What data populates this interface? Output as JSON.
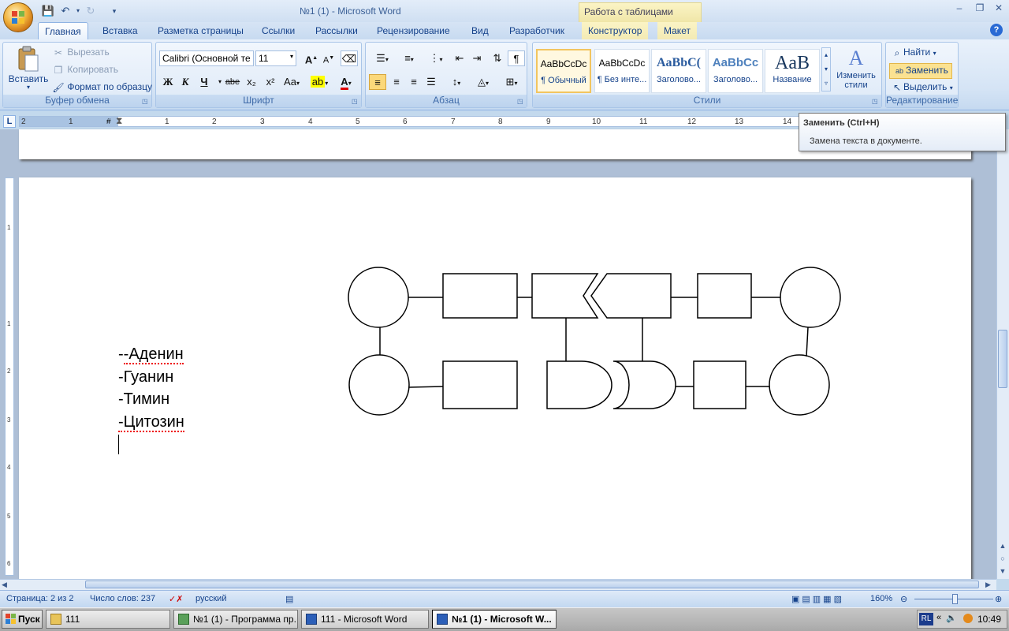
{
  "window": {
    "title": "№1 (1) - Microsoft Word",
    "context_tab": "Работа с таблицами"
  },
  "qat": {
    "save": "save-icon",
    "undo": "undo-icon",
    "redo": "redo-icon",
    "customize": "customize-icon"
  },
  "tabs": [
    "Главная",
    "Вставка",
    "Разметка страницы",
    "Ссылки",
    "Рассылки",
    "Рецензирование",
    "Вид",
    "Разработчик",
    "Конструктор",
    "Макет"
  ],
  "active_tab": "Главная",
  "clipboard": {
    "paste": "Вставить",
    "cut": "Вырезать",
    "copy": "Копировать",
    "format_painter": "Формат по образцу",
    "label": "Буфер обмена"
  },
  "font": {
    "name": "Calibri (Основной те",
    "size": "11",
    "label": "Шрифт",
    "bold": "Ж",
    "italic": "К",
    "underline": "Ч",
    "strike": "abe",
    "subscript": "x₂",
    "superscript": "x²",
    "case": "Aa",
    "grow": "A",
    "shrink": "A"
  },
  "paragraph": {
    "label": "Абзац",
    "pilcrow": "¶"
  },
  "styles": {
    "label": "Стили",
    "change_styles": "Изменить стили",
    "items": [
      {
        "sample": "AaBbCcDc",
        "name": "¶ Обычный"
      },
      {
        "sample": "AaBbCcDc",
        "name": "¶ Без инте..."
      },
      {
        "sample": "AaBbC(",
        "name": "Заголово..."
      },
      {
        "sample": "AaBbCc",
        "name": "Заголово..."
      },
      {
        "sample": "AaB",
        "name": "Название"
      }
    ]
  },
  "editing": {
    "label": "Редактирование",
    "find": "Найти",
    "replace": "Заменить",
    "select": "Выделить"
  },
  "tooltip": {
    "title": "Заменить (Ctrl+H)",
    "body": "Замена текста в документе."
  },
  "ruler": {
    "numbers": [
      "2",
      "1",
      "1",
      "2",
      "3",
      "4",
      "5",
      "6",
      "7",
      "8",
      "9",
      "10",
      "11",
      "12",
      "13",
      "14"
    ]
  },
  "vruler": {
    "numbers": [
      "1",
      "1",
      "2",
      "3",
      "4",
      "5",
      "6"
    ]
  },
  "document": {
    "lines": [
      "-Аденин",
      "-Гуанин",
      "-Тимин",
      "-Цитозин"
    ]
  },
  "status": {
    "page": "Страница: 2 из 2",
    "words": "Число слов: 237",
    "language": "русский",
    "zoom": "160%"
  },
  "taskbar": {
    "start": "Пуск",
    "tasks": [
      "111",
      "№1 (1) - Программа пр...",
      "111 - Microsoft Word",
      "№1 (1) - Microsoft W..."
    ],
    "lang": "RL",
    "clock": "10:49"
  }
}
